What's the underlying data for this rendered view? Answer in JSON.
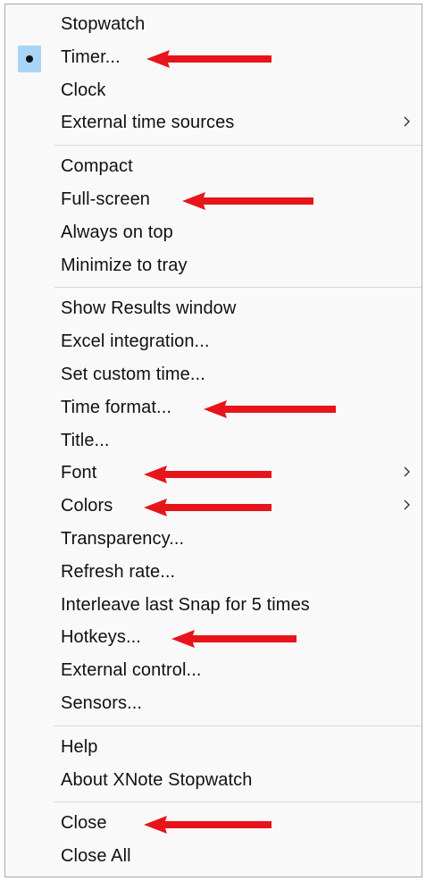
{
  "menu": {
    "groups": [
      {
        "items": [
          {
            "label": "Stopwatch",
            "checked": false,
            "submenu": false,
            "highlighted": false
          },
          {
            "label": "Timer...",
            "checked": true,
            "submenu": false,
            "highlighted": true
          },
          {
            "label": "Clock",
            "checked": false,
            "submenu": false,
            "highlighted": false
          },
          {
            "label": "External time sources",
            "checked": false,
            "submenu": true,
            "highlighted": false
          }
        ]
      },
      {
        "items": [
          {
            "label": "Compact",
            "checked": false,
            "submenu": false,
            "highlighted": false
          },
          {
            "label": "Full-screen",
            "checked": false,
            "submenu": false,
            "highlighted": true
          },
          {
            "label": "Always on top",
            "checked": false,
            "submenu": false,
            "highlighted": false
          },
          {
            "label": "Minimize to tray",
            "checked": false,
            "submenu": false,
            "highlighted": false
          }
        ]
      },
      {
        "items": [
          {
            "label": "Show Results window",
            "checked": false,
            "submenu": false,
            "highlighted": false
          },
          {
            "label": "Excel integration...",
            "checked": false,
            "submenu": false,
            "highlighted": false
          },
          {
            "label": "Set custom time...",
            "checked": false,
            "submenu": false,
            "highlighted": false
          },
          {
            "label": "Time format...",
            "checked": false,
            "submenu": false,
            "highlighted": true
          },
          {
            "label": "Title...",
            "checked": false,
            "submenu": false,
            "highlighted": false
          },
          {
            "label": "Font",
            "checked": false,
            "submenu": true,
            "highlighted": true
          },
          {
            "label": "Colors",
            "checked": false,
            "submenu": true,
            "highlighted": true
          },
          {
            "label": "Transparency...",
            "checked": false,
            "submenu": false,
            "highlighted": false
          },
          {
            "label": "Refresh rate...",
            "checked": false,
            "submenu": false,
            "highlighted": false
          },
          {
            "label": "Interleave last Snap for 5 times",
            "checked": false,
            "submenu": false,
            "highlighted": false
          },
          {
            "label": "Hotkeys...",
            "checked": false,
            "submenu": false,
            "highlighted": true
          },
          {
            "label": "External control...",
            "checked": false,
            "submenu": false,
            "highlighted": false
          },
          {
            "label": "Sensors...",
            "checked": false,
            "submenu": false,
            "highlighted": false
          }
        ]
      },
      {
        "items": [
          {
            "label": "Help",
            "checked": false,
            "submenu": false,
            "highlighted": false
          },
          {
            "label": "About XNote Stopwatch",
            "checked": false,
            "submenu": false,
            "highlighted": false
          }
        ]
      },
      {
        "items": [
          {
            "label": "Close",
            "checked": false,
            "submenu": false,
            "highlighted": true
          },
          {
            "label": "Close All",
            "checked": false,
            "submenu": false,
            "highlighted": false
          }
        ]
      }
    ]
  },
  "colors": {
    "menu_background": "#f9f9f9",
    "check_highlight": "#a8d4f7",
    "annotation_arrow": "#e8141b",
    "separator": "#d9d9d9"
  },
  "icons": {
    "check": "bullet-dot-icon",
    "submenu": "chevron-right-icon",
    "annotation": "red-arrow-icon"
  }
}
